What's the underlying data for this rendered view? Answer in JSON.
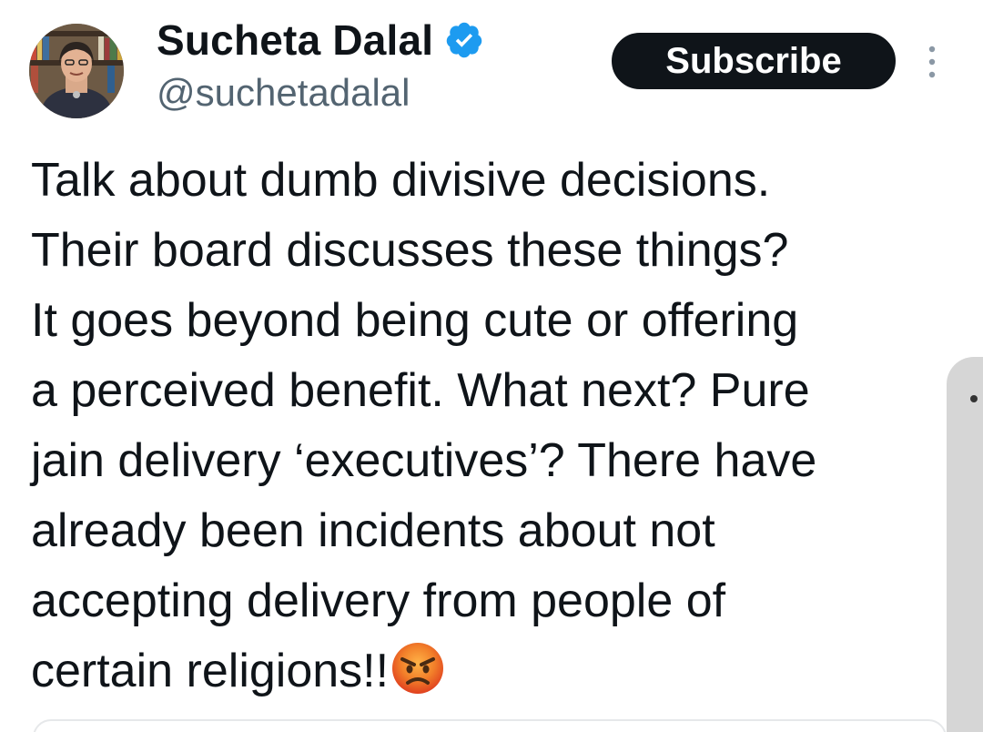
{
  "tweet": {
    "author": {
      "display_name": "Sucheta Dalal",
      "handle": "@suchetadalal",
      "verified_icon": "verified-badge-icon",
      "verified_color": "#1d9bf0"
    },
    "subscribe_label": "Subscribe",
    "more_icon": "more-vertical-icon",
    "text_lines": [
      "Talk about dumb divisive decisions.",
      "Their board discusses these things?",
      "It goes beyond being cute or offering",
      "a perceived benefit. What next? Pure",
      "jain delivery ‘executives’? There have",
      "already been incidents about not",
      "accepting delivery from people of",
      "certain religions!!"
    ],
    "emoji": "angry-face-emoji"
  },
  "colors": {
    "text": "#0f1419",
    "secondary_text": "#536471",
    "button_bg": "#0f1419",
    "button_text": "#ffffff"
  }
}
